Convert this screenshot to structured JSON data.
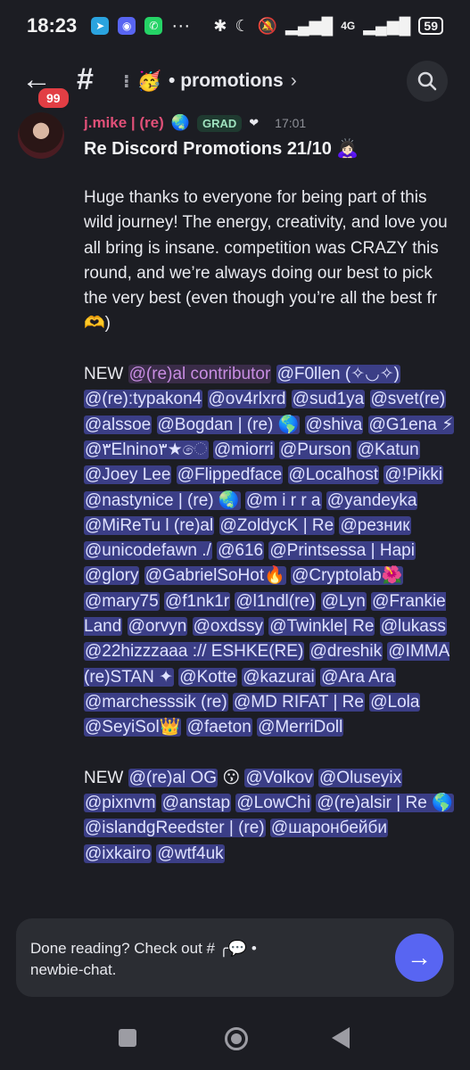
{
  "status": {
    "time": "18:23",
    "network": "4G",
    "battery": "59",
    "more": "···"
  },
  "topbar": {
    "unread_badge": "99",
    "hash": "#",
    "divider": "⁝",
    "channel_emoji": "🥳",
    "channel_name": "• promotions",
    "chevron": "›"
  },
  "message": {
    "username": "j.mike | (re)",
    "username_emoji": "🌏",
    "grad_badge": "GRAD",
    "heart": "❤",
    "timestamp": "17:01",
    "title": "Re Discord Promotions 21/10 🙇🏻‍♀️",
    "intro": "Huge thanks to everyone for being part of this wild journey! The energy, creativity, and love you all bring is insane. competition was CRAZY this round, and we’re always doing our best to pick the very best (even though you’re all the best fr 🫶)",
    "contributors_prefix": "NEW",
    "contributors_role": "@(re)al contributor",
    "contributors": [
      "@F0llen (✧◡✧)",
      "@(re):typakon4",
      "@ov4rlxrd",
      "@sud1ya",
      "@svet(re)",
      "@alssoe",
      "@Bogdan | (re) 🌎",
      "@shiva",
      "@G1ena ⚡",
      "@٣Elnino٣★ෙ",
      "@miorri",
      "@Purson",
      "@Katun",
      "@Joey Lee",
      "@Flippedface",
      "@Localhost",
      "@!Pikki",
      "@nastynice | (re) 🌏",
      "@m i r r a",
      "@yandeyka",
      "@MiReTu l (re)al",
      "@ZoldycK | Re",
      "@резник",
      "@unicodefawn ./",
      "@616",
      "@Printsessa | Hapi",
      "@glory",
      "@GabrielSoHot🔥",
      "@Cryptolab🌺",
      "@mary75",
      "@f1nk1r",
      "@l1ndl(re)",
      "@Lyn",
      "@Frankie Land",
      "@orvyn",
      "@oxdssy",
      "@Twinkle| Re",
      "@lukass",
      "@22hizzzaaa :// ESHKE(RE)",
      "@dreshik",
      "@IMMA (re)STAN ✦",
      "@Kotte",
      "@kazurai",
      "@Ara Ara",
      "@marchesssik (re)",
      "@MD RIFAT | Re",
      "@Lola",
      "@SeyiSol👑",
      "@faeton",
      "@MerriDoll"
    ],
    "og_prefix": "NEW",
    "og_role": "@(re)al OG",
    "og_emoji": "😗",
    "og": [
      "@Volkov",
      "@Oluseyix",
      "@pixnvm",
      "@anstap",
      "@LowChi",
      "@(re)alsir | Re 🌎",
      "@islandgReedster | (re)",
      "@шаронбейби",
      "@ixkairo",
      "@wtf4uk"
    ]
  },
  "composer": {
    "line1": "Done reading? Check out # ╭💬 •",
    "line2": "newbie-chat.",
    "send_icon": "→"
  }
}
